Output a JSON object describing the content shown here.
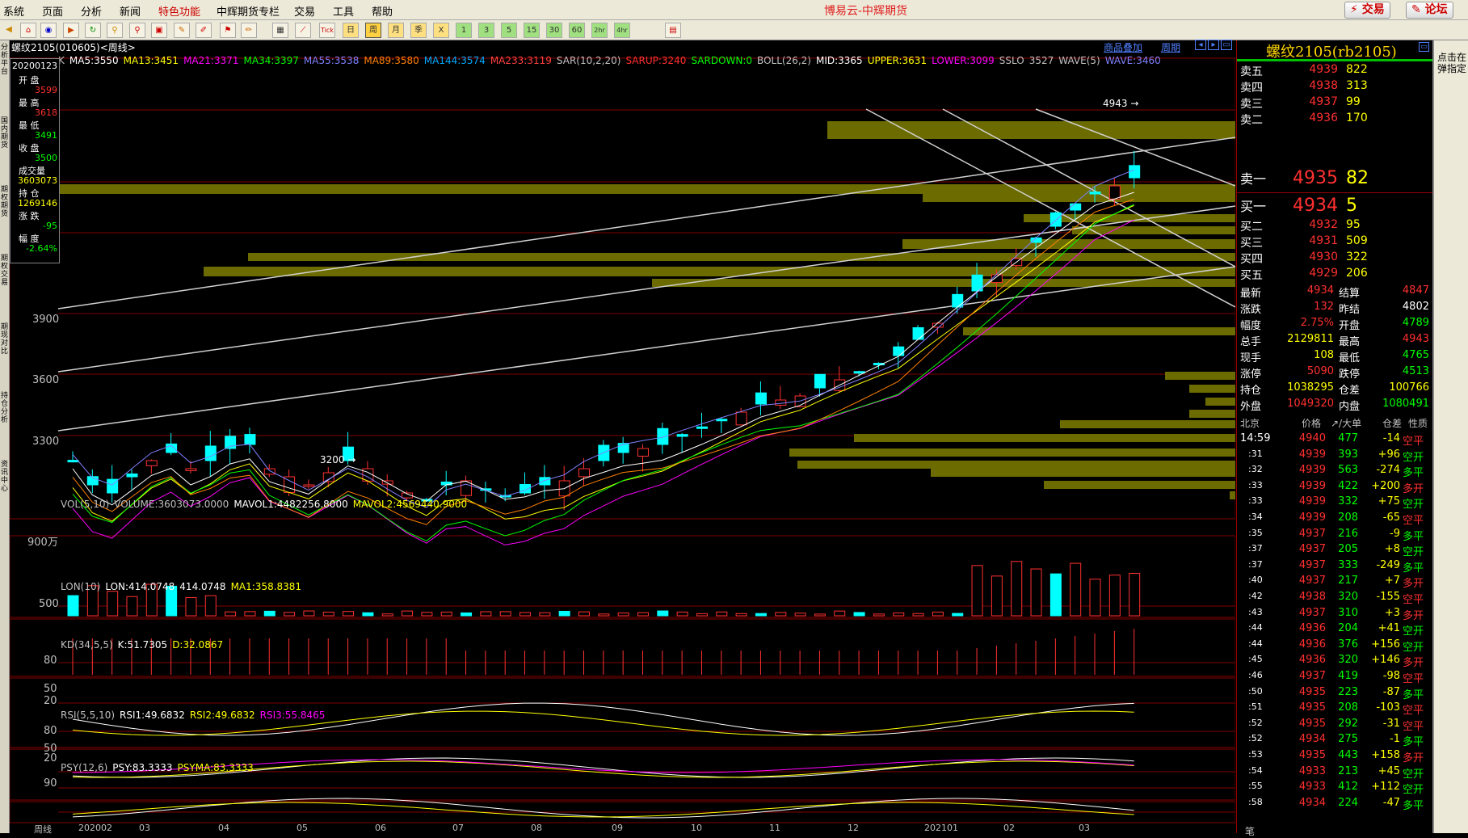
{
  "app_title": "博易云-中辉期货",
  "menu": [
    "系统",
    "页面",
    "分析",
    "新闻",
    "特色功能",
    "中辉期货专栏",
    "交易",
    "工具",
    "帮助"
  ],
  "top_buttons": {
    "trade": "交易",
    "forum": "论坛"
  },
  "toolbar_icons": [
    "back-icon",
    "home-icon",
    "refresh-icon",
    "video-icon",
    "reload-icon",
    "search-icon",
    "zoom-icon",
    "window-icon",
    "draw-icon",
    "paint-icon",
    "pin-icon",
    "edit-icon",
    "table-icon",
    "chart-icon",
    "tick-icon",
    "day-icon",
    "week-icon",
    "month-icon",
    "season-icon",
    "x-icon",
    "1-icon",
    "3-icon",
    "5-icon",
    "15-icon",
    "30-icon",
    "60-icon",
    "2hr-icon",
    "4hr-icon",
    "calc-icon"
  ],
  "toolbar_text": {
    "tick": "Tick",
    "day": "日",
    "week": "周",
    "month": "月",
    "season": "季",
    "x": "X",
    "m1": "1",
    "m3": "3",
    "m5": "5",
    "m15": "15",
    "m30": "30",
    "m60": "60",
    "h2": "2hr",
    "h4": "4hr"
  },
  "left_tabs": [
    "分析平台",
    "国内期货",
    "期权期货",
    "期权交易",
    "期现对比",
    "持仓分析",
    "资讯中心"
  ],
  "chart": {
    "symbol_title": "螺纹2105(010605)<周线>",
    "links": {
      "overlay": "商品叠加",
      "period": "周期"
    },
    "ma_line": [
      {
        "t": "K",
        "c": "#c0c0c0"
      },
      {
        "t": "MA5:3550",
        "c": "#ffffff"
      },
      {
        "t": "MA13:3451",
        "c": "#ffff00"
      },
      {
        "t": "MA21:3371",
        "c": "#ff00ff"
      },
      {
        "t": "MA34:3397",
        "c": "#00ff00"
      },
      {
        "t": "MA55:3538",
        "c": "#8080ff"
      },
      {
        "t": "MA89:3580",
        "c": "#ff8000"
      },
      {
        "t": "MA144:3574",
        "c": "#00aaff"
      },
      {
        "t": "MA233:3119",
        "c": "#ff4040"
      },
      {
        "t": "SAR(10,2,20)",
        "c": "#c0c0c0"
      },
      {
        "t": "SARUP:3240",
        "c": "#ff3030"
      },
      {
        "t": "SARDOWN:0",
        "c": "#00ff00"
      },
      {
        "t": "BOLL(26,2)",
        "c": "#c0c0c0"
      },
      {
        "t": "MID:3365",
        "c": "#ffffff"
      },
      {
        "t": "UPPER:3631",
        "c": "#ffff00"
      },
      {
        "t": "LOWER:3099",
        "c": "#ff00ff"
      },
      {
        "t": "SSLO",
        "c": "#c0c0c0"
      },
      {
        "t": "3527",
        "c": "#c0c0c0"
      },
      {
        "t": "WAVE(5)",
        "c": "#c0c0c0"
      },
      {
        "t": "WAVE:3460",
        "c": "#8080ff"
      }
    ],
    "info_box": {
      "date": "20200123",
      "rows": [
        {
          "label": "开  盘",
          "value": "3599",
          "color": "#ff3030"
        },
        {
          "label": "最  高",
          "value": "3618",
          "color": "#ff3030"
        },
        {
          "label": "最  低",
          "value": "3491",
          "color": "#00ff00"
        },
        {
          "label": "收  盘",
          "value": "3500",
          "color": "#00ff00"
        },
        {
          "label": "成交量",
          "value": "3603073",
          "color": "#ffff00"
        },
        {
          "label": "持  仓",
          "value": "1269146",
          "color": "#ffff00"
        },
        {
          "label": "涨  跌",
          "value": "-95",
          "color": "#00ff00"
        },
        {
          "label": "幅  度",
          "value": "-2.64%",
          "color": "#00ff00"
        }
      ]
    },
    "price_ticks": [
      "3900",
      "3600",
      "3300"
    ],
    "annotations": {
      "high": "4943",
      "low": "3200"
    },
    "vol_line": [
      {
        "t": "VOL(5,10)",
        "c": "#c0c0c0"
      },
      {
        "t": "VOLUME:3603073.0000",
        "c": "#c0c0c0"
      },
      {
        "t": "MAVOL1:4482256.8000",
        "c": "#ffffff"
      },
      {
        "t": "MAVOL2:4569440.9000",
        "c": "#ffff00"
      }
    ],
    "vol_tick": "900万",
    "lon_line": [
      {
        "t": "LON(10)",
        "c": "#c0c0c0"
      },
      {
        "t": "LON:414.0748",
        "c": "#ffffff"
      },
      {
        "t": "414.0748",
        "c": "#ffffff"
      },
      {
        "t": "MA1:358.8381",
        "c": "#ffff00"
      }
    ],
    "lon_tick": "500",
    "kd_line": [
      {
        "t": "KD(34,5,5)",
        "c": "#c0c0c0"
      },
      {
        "t": "K:51.7305",
        "c": "#ffffff"
      },
      {
        "t": "D:32.0867",
        "c": "#ffff00"
      }
    ],
    "kd_ticks": [
      "80",
      "50",
      "20"
    ],
    "rsi_line": [
      {
        "t": "RSI(5,5,10)",
        "c": "#c0c0c0"
      },
      {
        "t": "RSI1:49.6832",
        "c": "#ffffff"
      },
      {
        "t": "RSI2:49.6832",
        "c": "#ffff00"
      },
      {
        "t": "RSI3:55.8465",
        "c": "#ff00ff"
      }
    ],
    "rsi_ticks": [
      "80",
      "50",
      "20"
    ],
    "psy_line": [
      {
        "t": "PSY(12,6)",
        "c": "#c0c0c0"
      },
      {
        "t": "PSY:83.3333",
        "c": "#ffffff"
      },
      {
        "t": "PSYMA:83.3333",
        "c": "#ffff00"
      }
    ],
    "psy_tick": "90",
    "x_labels": [
      "周线",
      "202002",
      "03",
      "04",
      "05",
      "06",
      "07",
      "08",
      "09",
      "10",
      "11",
      "12",
      "202101",
      "02",
      "03"
    ]
  },
  "quote": {
    "title": "螺纹2105(rb2105)",
    "asks": [
      {
        "label": "卖五",
        "price": "4939",
        "vol": "822"
      },
      {
        "label": "卖四",
        "price": "4938",
        "vol": "313"
      },
      {
        "label": "卖三",
        "price": "4937",
        "vol": "99"
      },
      {
        "label": "卖二",
        "price": "4936",
        "vol": "170"
      },
      {
        "label": "卖一",
        "price": "4935",
        "vol": "82"
      }
    ],
    "bids": [
      {
        "label": "买一",
        "price": "4934",
        "vol": "5"
      },
      {
        "label": "买二",
        "price": "4932",
        "vol": "95"
      },
      {
        "label": "买三",
        "price": "4931",
        "vol": "509"
      },
      {
        "label": "买四",
        "price": "4930",
        "vol": "322"
      },
      {
        "label": "买五",
        "price": "4929",
        "vol": "206"
      }
    ],
    "stats": [
      {
        "l1": "最新",
        "v1": "4934",
        "c1": "#ff3030",
        "l2": "结算",
        "v2": "4847",
        "c2": "#ff3030"
      },
      {
        "l1": "涨跌",
        "v1": "132",
        "c1": "#ff3030",
        "l2": "昨结",
        "v2": "4802",
        "c2": "#ffffff"
      },
      {
        "l1": "幅度",
        "v1": "2.75%",
        "c1": "#ff3030",
        "l2": "开盘",
        "v2": "4789",
        "c2": "#00ff00"
      },
      {
        "l1": "总手",
        "v1": "2129811",
        "c1": "#ffff00",
        "l2": "最高",
        "v2": "4943",
        "c2": "#ff3030"
      },
      {
        "l1": "现手",
        "v1": "108",
        "c1": "#ffff00",
        "l2": "最低",
        "v2": "4765",
        "c2": "#00ff00"
      },
      {
        "l1": "涨停",
        "v1": "5090",
        "c1": "#ff3030",
        "l2": "跌停",
        "v2": "4513",
        "c2": "#00ff00"
      },
      {
        "l1": "持仓",
        "v1": "1038295",
        "c1": "#ffff00",
        "l2": "仓差",
        "v2": "100766",
        "c2": "#ffff00"
      },
      {
        "l1": "外盘",
        "v1": "1049320",
        "c1": "#ff3030",
        "l2": "内盘",
        "v2": "1080491",
        "c2": "#00ff00"
      }
    ],
    "tick_header": {
      "loc": "北京",
      "price": "价格",
      "vol": "↗/大单",
      "oi": "仓差",
      "nature": "性质"
    },
    "ticks": [
      {
        "t": "14:59",
        "p": "4940",
        "v": "477",
        "d": "-14",
        "n": "空平"
      },
      {
        "t": ":31",
        "p": "4939",
        "v": "393",
        "d": "+96",
        "n": "空开"
      },
      {
        "t": ":32",
        "p": "4939",
        "v": "563",
        "d": "-274",
        "n": "多平"
      },
      {
        "t": ":33",
        "p": "4939",
        "v": "422",
        "d": "+200",
        "n": "多开"
      },
      {
        "t": ":33",
        "p": "4939",
        "v": "332",
        "d": "+75",
        "n": "空开"
      },
      {
        "t": ":34",
        "p": "4939",
        "v": "208",
        "d": "-65",
        "n": "空平"
      },
      {
        "t": ":35",
        "p": "4937",
        "v": "216",
        "d": "-9",
        "n": "多平"
      },
      {
        "t": ":37",
        "p": "4937",
        "v": "205",
        "d": "+8",
        "n": "空开"
      },
      {
        "t": ":37",
        "p": "4937",
        "v": "333",
        "d": "-249",
        "n": "多平"
      },
      {
        "t": ":40",
        "p": "4937",
        "v": "217",
        "d": "+7",
        "n": "多开"
      },
      {
        "t": ":42",
        "p": "4938",
        "v": "320",
        "d": "-155",
        "n": "空平"
      },
      {
        "t": ":43",
        "p": "4937",
        "v": "310",
        "d": "+3",
        "n": "多开"
      },
      {
        "t": ":44",
        "p": "4936",
        "v": "204",
        "d": "+41",
        "n": "空开"
      },
      {
        "t": ":44",
        "p": "4936",
        "v": "376",
        "d": "+156",
        "n": "空开"
      },
      {
        "t": ":45",
        "p": "4936",
        "v": "320",
        "d": "+146",
        "n": "多开"
      },
      {
        "t": ":46",
        "p": "4937",
        "v": "419",
        "d": "-98",
        "n": "空平"
      },
      {
        "t": ":50",
        "p": "4935",
        "v": "223",
        "d": "-87",
        "n": "多平"
      },
      {
        "t": ":51",
        "p": "4935",
        "v": "208",
        "d": "-103",
        "n": "空平"
      },
      {
        "t": ":52",
        "p": "4935",
        "v": "292",
        "d": "-31",
        "n": "空平"
      },
      {
        "t": ":52",
        "p": "4934",
        "v": "275",
        "d": "-1",
        "n": "多平"
      },
      {
        "t": ":53",
        "p": "4935",
        "v": "443",
        "d": "+158",
        "n": "多开"
      },
      {
        "t": ":54",
        "p": "4933",
        "v": "213",
        "d": "+45",
        "n": "空开"
      },
      {
        "t": ":55",
        "p": "4933",
        "v": "412",
        "d": "+112",
        "n": "空开"
      },
      {
        "t": ":58",
        "p": "4934",
        "v": "224",
        "d": "-47",
        "n": "多平"
      }
    ],
    "footer": "笔"
  },
  "far_right_text": "点击在弹指定"
}
